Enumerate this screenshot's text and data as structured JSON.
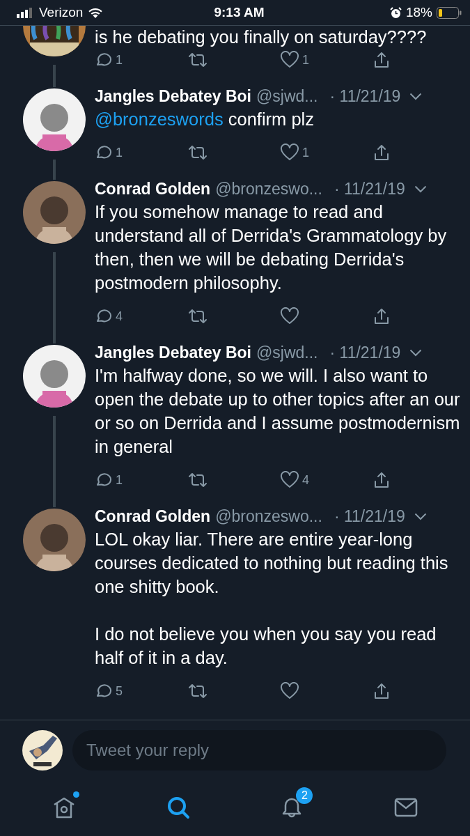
{
  "status_bar": {
    "carrier": "Verizon",
    "time": "9:13 AM",
    "battery": "18%"
  },
  "tweets": [
    {
      "partial": true,
      "paragraphs": [
        {
          "text": "is he debating you finally on saturday????"
        }
      ],
      "replies": "1",
      "likes": "1",
      "liked": false
    },
    {
      "name": "Jangles Debatey Boi",
      "handle": "@sjwd...",
      "date": "· 11/21/19",
      "paragraphs": [
        {
          "mention": "@bronzeswords",
          "text": "confirm plz"
        }
      ],
      "replies": "1",
      "likes": "1",
      "liked": false
    },
    {
      "name": "Conrad Golden",
      "handle": "@bronzeswo...",
      "date": "· 11/21/19",
      "paragraphs": [
        {
          "text": "If you somehow manage to read and understand all of Derrida's Grammatology by then, then we will be debating Derrida's postmodern philosophy."
        }
      ],
      "replies": "4",
      "liked": false
    },
    {
      "name": "Jangles Debatey Boi",
      "handle": "@sjwd...",
      "date": "· 11/21/19",
      "paragraphs": [
        {
          "text": "I'm halfway done, so we will. I also want to open the debate up to other topics after an our or so on Derrida and I assume postmodernism in general"
        }
      ],
      "replies": "1",
      "likes": "4",
      "liked": false
    },
    {
      "name": "Conrad Golden",
      "handle": "@bronzeswo...",
      "date": "· 11/21/19",
      "paragraphs": [
        {
          "text": "LOL okay liar. There are entire year-long courses dedicated to nothing but reading this one shitty book."
        },
        {
          "text": "I do not believe you when you say you read half of it in a day."
        }
      ],
      "replies": "5",
      "liked": false
    }
  ],
  "reply_bar": {
    "placeholder": "Tweet your reply"
  },
  "nav": [
    {
      "kind": "home",
      "selected": false,
      "dot": true
    },
    {
      "kind": "search",
      "selected": true
    },
    {
      "kind": "notifications",
      "selected": false,
      "badge": "2"
    },
    {
      "kind": "messages",
      "selected": false
    }
  ]
}
